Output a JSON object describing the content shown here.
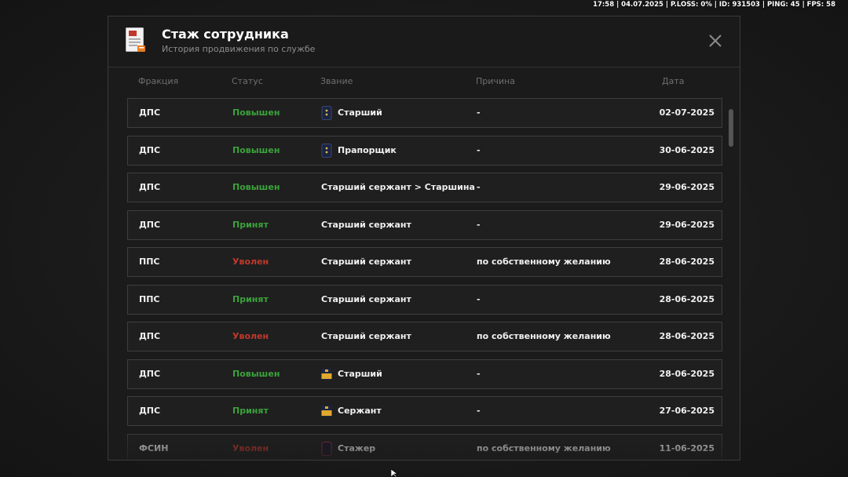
{
  "hud": {
    "text": "17:58 | 04.07.2025 | P.LOSS: 0% | ID: 931503 | PING: 45 | FPS: 58"
  },
  "modal": {
    "title": "Стаж сотрудника",
    "subtitle": "История продвижения по службе",
    "icon": "document-icon",
    "close_icon": "close-icon"
  },
  "columns": {
    "faction": "Фракция",
    "status": "Статус",
    "rank": "Звание",
    "reason": "Причина",
    "date": "Дата"
  },
  "colors": {
    "promoted": "#3aa33a",
    "hired": "#3aa33a",
    "fired": "#c0392b"
  },
  "rows": [
    {
      "faction": "ДПС",
      "status": "Повышен",
      "status_type": "green",
      "rank": "Старший",
      "rank_icon": "navy-epaulette-icon",
      "reason": "-",
      "date": "02-07-2025"
    },
    {
      "faction": "ДПС",
      "status": "Повышен",
      "status_type": "green",
      "rank": "Прапорщик",
      "rank_icon": "navy-epaulette-icon",
      "reason": "-",
      "date": "30-06-2025"
    },
    {
      "faction": "ДПС",
      "status": "Повышен",
      "status_type": "green",
      "rank": "Старший сержант > Старшина",
      "rank_icon": "",
      "reason": "-",
      "date": "29-06-2025"
    },
    {
      "faction": "ДПС",
      "status": "Принят",
      "status_type": "green",
      "rank": "Старший сержант",
      "rank_icon": "",
      "reason": "-",
      "date": "29-06-2025"
    },
    {
      "faction": "ППС",
      "status": "Уволен",
      "status_type": "red",
      "rank": "Старший сержант",
      "rank_icon": "",
      "reason": "по собственному желанию",
      "date": "28-06-2025"
    },
    {
      "faction": "ППС",
      "status": "Принят",
      "status_type": "green",
      "rank": "Старший сержант",
      "rank_icon": "",
      "reason": "-",
      "date": "28-06-2025"
    },
    {
      "faction": "ДПС",
      "status": "Уволен",
      "status_type": "red",
      "rank": "Старший сержант",
      "rank_icon": "",
      "reason": "по собственному желанию",
      "date": "28-06-2025"
    },
    {
      "faction": "ДПС",
      "status": "Повышен",
      "status_type": "green",
      "rank": "Старший",
      "rank_icon": "gold-stripe-icon",
      "reason": "-",
      "date": "28-06-2025"
    },
    {
      "faction": "ДПС",
      "status": "Принят",
      "status_type": "green",
      "rank": "Сержант",
      "rank_icon": "gold-stripe-icon",
      "reason": "-",
      "date": "27-06-2025"
    },
    {
      "faction": "ФСИН",
      "status": "Уволен",
      "status_type": "red",
      "rank": "Стажер",
      "rank_icon": "plain-epaulette-icon",
      "reason": "по собственному желанию",
      "date": "11-06-2025"
    }
  ]
}
